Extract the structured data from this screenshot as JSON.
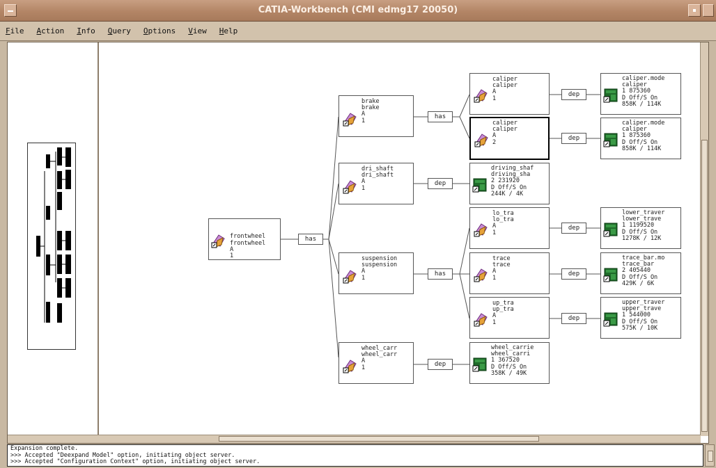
{
  "window": {
    "title": "CATIA-Workbench (CMI edmg17 20050)"
  },
  "menu": [
    "File",
    "Action",
    "Info",
    "Query",
    "Options",
    "View",
    "Help"
  ],
  "colors": {
    "titlebar": "#b38566",
    "menubar": "#d2c2ac",
    "canvas": "#ffffff",
    "icon_model": "#c98ad4",
    "icon_doc": "#1f6b2a"
  },
  "tree": {
    "root": {
      "lines": [
        "frontwheel",
        "frontwheel",
        "A",
        "1"
      ]
    },
    "root_rel": "has",
    "level1": [
      {
        "lines": [
          "brake",
          "brake",
          "A",
          "1"
        ],
        "rel": "has"
      },
      {
        "lines": [
          "dri_shaft",
          "dri_shaft",
          "A",
          "1"
        ],
        "rel": "dep"
      },
      {
        "lines": [
          "suspension",
          "suspension",
          "A",
          "1"
        ],
        "rel": "has"
      },
      {
        "lines": [
          "wheel_carr",
          "wheel_carr",
          "A",
          "1"
        ],
        "rel": "dep"
      }
    ],
    "level2": [
      {
        "lines": [
          "caliper",
          "caliper",
          "A",
          "1"
        ],
        "rel": "dep",
        "icon": "model-icon"
      },
      {
        "lines": [
          "caliper",
          "caliper",
          "A",
          "2"
        ],
        "rel": "dep",
        "icon": "model-icon",
        "selected": true
      },
      {
        "lines": [
          "driving_shaf",
          "driving_sha",
          "2  231920",
          "D Off/S On",
          "244K / 4K"
        ],
        "icon": "document-icon"
      },
      {
        "lines": [
          "lo_tra",
          "lo_tra",
          "A",
          "1"
        ],
        "rel": "dep",
        "icon": "model-icon"
      },
      {
        "lines": [
          "trace",
          "trace",
          "A",
          "1"
        ],
        "rel": "dep",
        "icon": "model-icon"
      },
      {
        "lines": [
          "up_tra",
          "up_tra",
          "A",
          "1"
        ],
        "rel": "dep",
        "icon": "model-icon"
      },
      {
        "lines": [
          "wheel_carrie",
          "wheel_carri",
          "1  367520",
          "D Off/S On",
          "358K / 49K"
        ],
        "icon": "document-icon"
      }
    ],
    "level3": [
      {
        "lines": [
          "caliper.mode",
          "caliper",
          "1  875360",
          "D Off/S On",
          "858K / 114K"
        ]
      },
      {
        "lines": [
          "caliper.mode",
          "caliper",
          "1  875360",
          "D Off/S On",
          "858K / 114K"
        ]
      },
      {
        "lines": [
          "lower_traver",
          "lower_trave",
          "1  1199520",
          "D Off/S On",
          "1278K / 12K"
        ]
      },
      {
        "lines": [
          "trace_bar.mo",
          "trace_bar",
          "2  405440",
          "D Off/S On",
          "429K / 6K"
        ]
      },
      {
        "lines": [
          "upper_traver",
          "upper_trave",
          "1  544000",
          "D Off/S On",
          "575K / 10K"
        ]
      }
    ]
  },
  "console": {
    "lines": [
      "Expansion complete.",
      ">>> Accepted \"Deexpand Model\" option, initiating object server.",
      ">>> Accepted \"Configuration Context\" option, initiating object server."
    ]
  }
}
